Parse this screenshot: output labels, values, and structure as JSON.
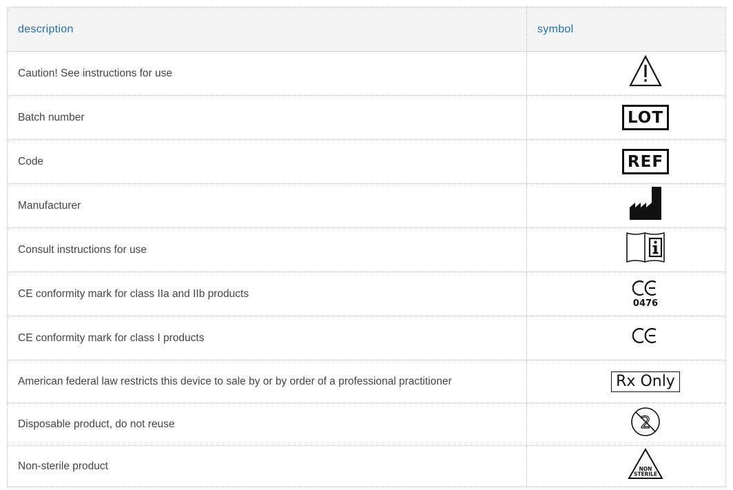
{
  "table": {
    "headers": {
      "description": "description",
      "symbol": "symbol"
    },
    "rows": [
      {
        "description": "Caution! See instructions for use",
        "symbol": "caution-triangle-icon"
      },
      {
        "description": "Batch number",
        "symbol": "lot-symbol",
        "symbol_text": "LOT"
      },
      {
        "description": "Code",
        "symbol": "ref-symbol",
        "symbol_text": "REF"
      },
      {
        "description": "Manufacturer",
        "symbol": "manufacturer-factory-icon"
      },
      {
        "description": "Consult instructions for use",
        "symbol": "instructions-book-icon"
      },
      {
        "description": "CE conformity mark for class IIa and IIb products",
        "symbol": "ce-mark-icon",
        "symbol_text": "0476"
      },
      {
        "description": "CE conformity mark for class I products",
        "symbol": "ce-mark-icon"
      },
      {
        "description": "American federal law restricts this device to sale by or by order of a professional practitioner",
        "symbol": "rx-only-symbol",
        "symbol_text": "Rx Only"
      },
      {
        "description": "Disposable product, do not reuse",
        "symbol": "do-not-reuse-icon",
        "symbol_text": "2"
      },
      {
        "description": "Non-sterile product",
        "symbol": "non-sterile-triangle-icon",
        "symbol_text_line1": "NON",
        "symbol_text_line2": "STERILE"
      }
    ]
  },
  "colors": {
    "header_text": "#1f6fb2",
    "header_bg": "#f4f4f4",
    "body_text": "#444444",
    "symbol": "#111111",
    "grid": "#bdbdbd"
  }
}
